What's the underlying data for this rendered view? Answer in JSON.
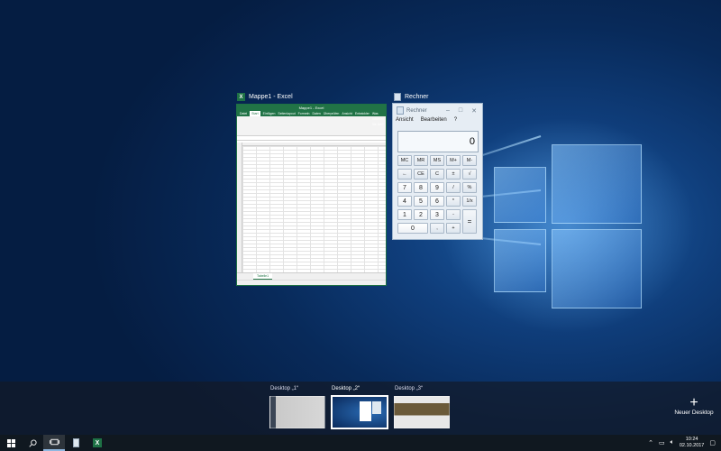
{
  "windows": {
    "excel": {
      "title": "Mappe1 - Excel",
      "doc_title": "Mappe1 - Excel",
      "ribbon_tabs": [
        "Datei",
        "Start",
        "Einfügen",
        "Seitenlayout",
        "Formeln",
        "Daten",
        "Überprüfen",
        "Ansicht",
        "Entwickler",
        "Was möchten Sie tun?"
      ],
      "sheet_tab": "Tabelle1"
    },
    "calculator": {
      "title": "Rechner",
      "inner_title": "Rechner",
      "menu": [
        "Ansicht",
        "Bearbeiten",
        "?"
      ],
      "display": "0",
      "buttons": [
        [
          "MC",
          "MR",
          "MS",
          "M+",
          "M-"
        ],
        [
          "←",
          "CE",
          "C",
          "±",
          "√"
        ],
        [
          "7",
          "8",
          "9",
          "/",
          "%"
        ],
        [
          "4",
          "5",
          "6",
          "*",
          "1/x"
        ],
        [
          "1",
          "2",
          "3",
          "-",
          "="
        ],
        [
          "0",
          ",",
          "+"
        ]
      ]
    }
  },
  "virtual_desktops": {
    "desktops": [
      {
        "label": "Desktop „1“"
      },
      {
        "label": "Desktop „2“"
      },
      {
        "label": "Desktop „3“"
      }
    ],
    "new_desktop_label": "Neuer Desktop",
    "new_desktop_icon": "plus-icon"
  },
  "taskbar": {
    "icons": [
      "windows-start-icon",
      "search-icon",
      "task-view-icon",
      "calculator-icon",
      "excel-icon"
    ],
    "time": "10:24",
    "date": "02.10.2017"
  }
}
